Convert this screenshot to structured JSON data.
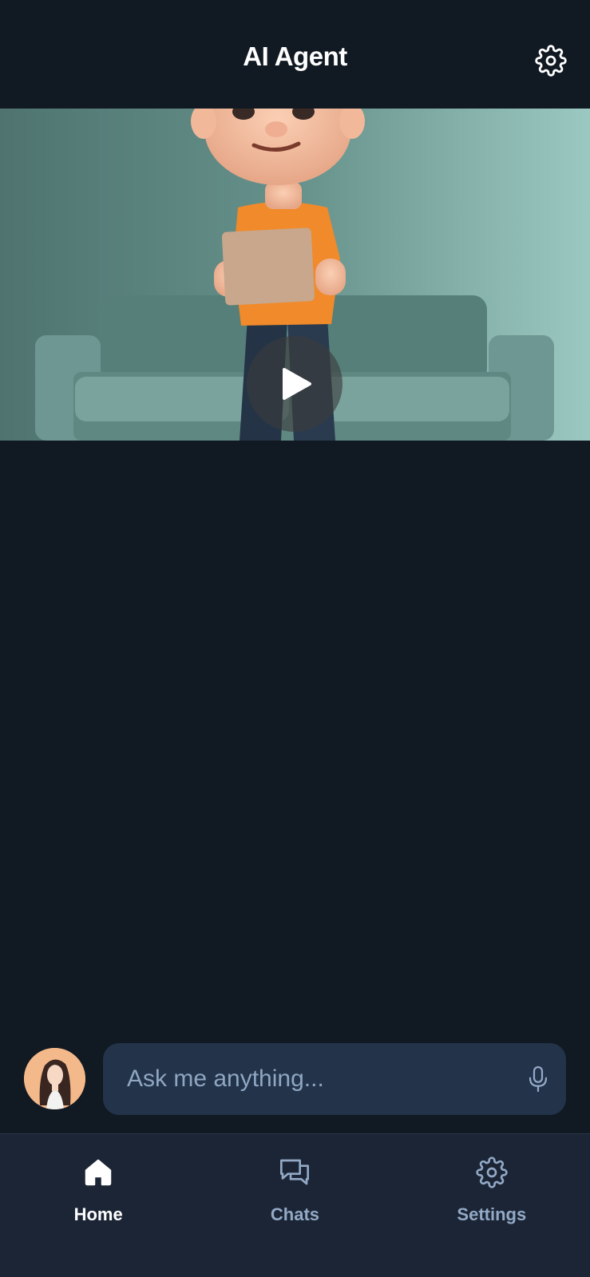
{
  "header": {
    "title": "AI Agent",
    "settings_icon": "gear-icon"
  },
  "video": {
    "play_icon": "play-icon"
  },
  "composer": {
    "placeholder": "Ask me anything...",
    "mic_icon": "microphone-icon",
    "avatar": "user-avatar"
  },
  "nav": {
    "items": [
      {
        "label": "Home",
        "icon": "home-icon",
        "active": true
      },
      {
        "label": "Chats",
        "icon": "chat-bubbles-icon",
        "active": false
      },
      {
        "label": "Settings",
        "icon": "gear-icon",
        "active": false
      }
    ]
  },
  "colors": {
    "background": "#111922",
    "nav_background": "#1b2535",
    "input_background": "#22334a",
    "active": "#ffffff",
    "inactive": "#93a9c6"
  }
}
